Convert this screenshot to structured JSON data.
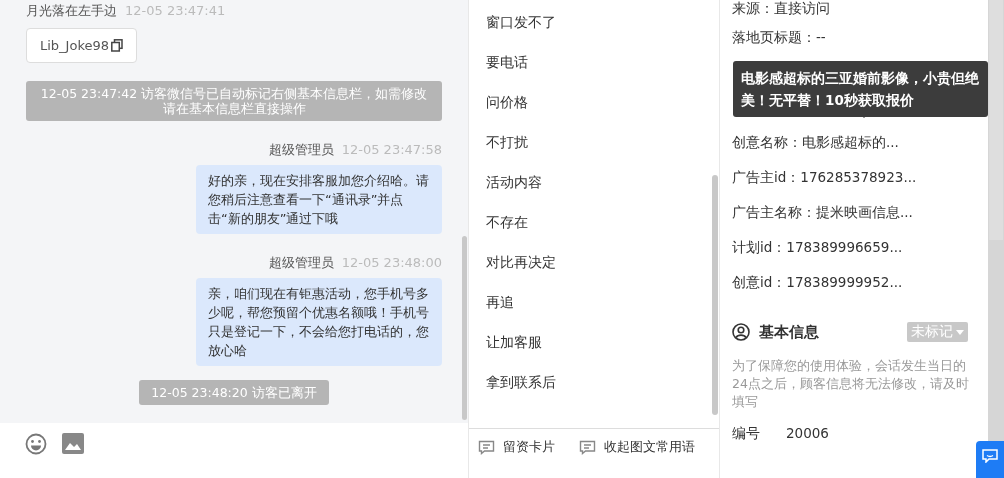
{
  "chat": {
    "messages": [
      {
        "kind": "visitor",
        "sender": "月光落在左手边",
        "time": "12-05 23:47:41",
        "card": "Lib_Joke98"
      },
      {
        "kind": "system",
        "text": "12-05 23:47:42 访客微信号已自动标记右侧基本信息栏，如需修改请在基本信息栏直接操作"
      },
      {
        "kind": "agent",
        "sender": "超级管理员",
        "time": "12-05 23:47:58",
        "text": "好的亲，现在安排客服加您介绍哈。请您稍后注意查看一下“通讯录”并点击“新的朋友”通过下哦"
      },
      {
        "kind": "agent",
        "sender": "超级管理员",
        "time": "12-05 23:48:00",
        "text": "亲，咱们现在有钜惠活动，您手机号多少呢，帮您预留个优惠名额哦！手机号只是登记一下，不会给您打电话的，您放心哈"
      },
      {
        "kind": "system",
        "text": "12-05 23:48:20 访客已离开"
      }
    ]
  },
  "quick_replies": {
    "items": [
      "窗口发不了",
      "要电话",
      "问价格",
      "不打扰",
      "活动内容",
      "不存在",
      "对比再决定",
      "再追",
      "让加客服",
      "拿到联系后"
    ],
    "actions": [
      "留资卡片",
      "收起图文常用语"
    ]
  },
  "info": {
    "rows": [
      {
        "label": "来源：",
        "value": "直接访问"
      },
      {
        "label": "落地页标题：",
        "value": "--"
      },
      {
        "label": "创意名称：",
        "value": "电影感超标的..."
      },
      {
        "label": "广告主id：",
        "value": "176285378923..."
      },
      {
        "label": "广告主名称：",
        "value": "提米映画信息..."
      },
      {
        "label": "计划id：",
        "value": "178389996659..."
      },
      {
        "label": "创意id：",
        "value": "178389999952..."
      }
    ],
    "tooltip": "电影感超标的三亚婚前影像，小贵但绝美！无平替！10秒获取报价",
    "basic": {
      "title": "基本信息",
      "tag": "未标记",
      "note": "为了保障您的使用体验，会话发生当日的24点之后，顾客信息将无法修改，请及时填写",
      "fields": [
        {
          "label": "编号",
          "value": "20006"
        }
      ]
    }
  }
}
